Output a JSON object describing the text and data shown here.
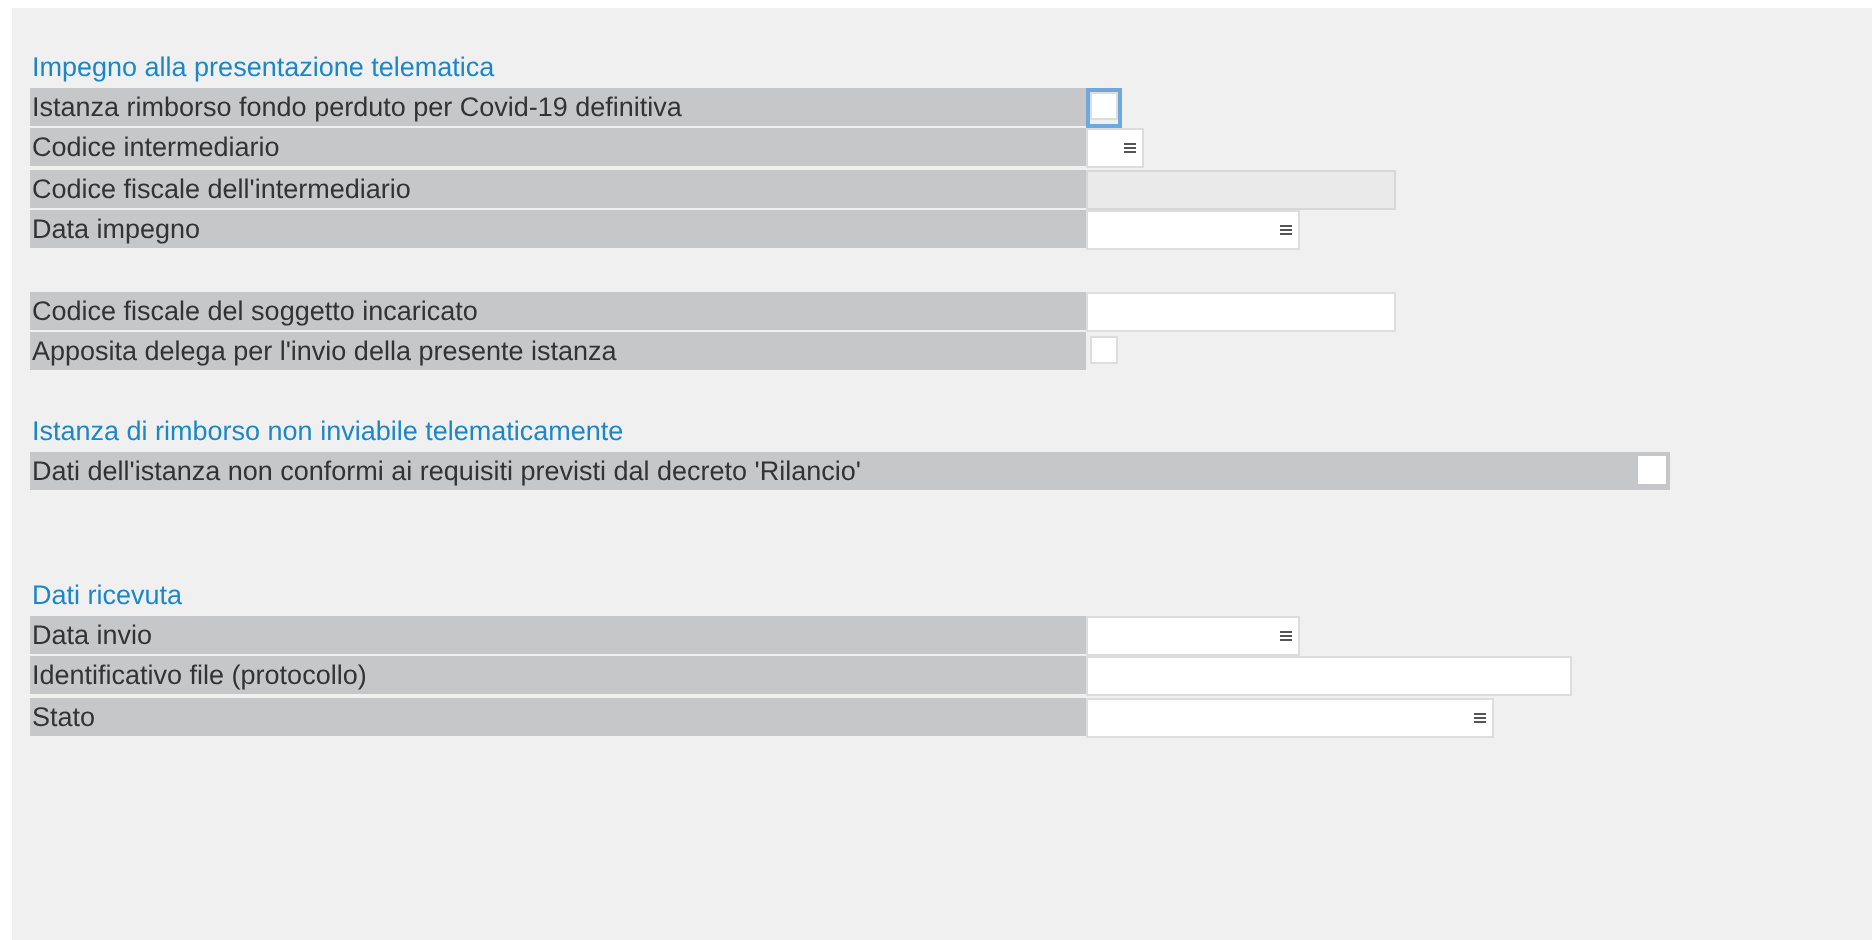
{
  "sections": [
    {
      "title": "Impegno alla presentazione telematica",
      "rows": [
        {
          "label": "Istanza rimborso fondo perduto per Covid-19 definitiva",
          "kind": "checkbox",
          "checked": false,
          "focused": true
        },
        {
          "label": "Codice intermediario",
          "kind": "select"
        },
        {
          "label": "Codice fiscale dell'intermediario",
          "kind": "text",
          "disabled": true
        },
        {
          "label": "Data impegno",
          "kind": "date"
        }
      ]
    },
    {
      "rows": [
        {
          "label": "Codice fiscale del soggetto incaricato",
          "kind": "text",
          "disabled": false
        },
        {
          "label": "Apposita delega per l'invio della presente istanza",
          "kind": "checkbox",
          "checked": false
        }
      ]
    },
    {
      "title": "Istanza di rimborso non inviabile telematicamente",
      "rows": [
        {
          "label": "Dati dell'istanza non conformi ai requisiti previsti dal decreto 'Rilancio'",
          "kind": "checkbox",
          "checked": false
        }
      ]
    },
    {
      "title": "Dati ricevuta",
      "rows": [
        {
          "label": "Data invio",
          "kind": "date"
        },
        {
          "label": "Identificativo file (protocollo)",
          "kind": "text",
          "disabled": false
        },
        {
          "label": "Stato",
          "kind": "select"
        }
      ]
    }
  ]
}
